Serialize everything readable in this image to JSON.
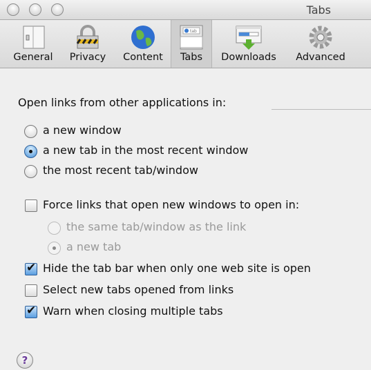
{
  "window": {
    "title": "Tabs"
  },
  "toolbar": {
    "items": [
      {
        "label": "General",
        "icon": "light-switch-icon"
      },
      {
        "label": "Privacy",
        "icon": "padlock-icon"
      },
      {
        "label": "Content",
        "icon": "globe-icon"
      },
      {
        "label": "Tabs",
        "icon": "tabs-icon",
        "selected": true
      },
      {
        "label": "Downloads",
        "icon": "download-icon"
      },
      {
        "label": "Advanced",
        "icon": "gear-icon"
      }
    ],
    "tab_icon_text": "tab"
  },
  "open_links": {
    "label": "Open links from other applications in:",
    "options": [
      {
        "label": "a new window",
        "selected": false
      },
      {
        "label": "a new tab in the most recent window",
        "selected": true
      },
      {
        "label": "the most recent tab/window",
        "selected": false
      }
    ]
  },
  "force": {
    "label": "Force links that open new windows to open in:",
    "checked": false,
    "options": [
      {
        "label": "the same tab/window as the link",
        "selected": false
      },
      {
        "label": "a new tab",
        "selected": true
      }
    ]
  },
  "checkboxes": [
    {
      "label": "Hide the tab bar when only one web site is open",
      "checked": true
    },
    {
      "label": "Select new tabs opened from links",
      "checked": false
    },
    {
      "label": "Warn when closing multiple tabs",
      "checked": true
    }
  ],
  "help": {
    "label": "?"
  }
}
